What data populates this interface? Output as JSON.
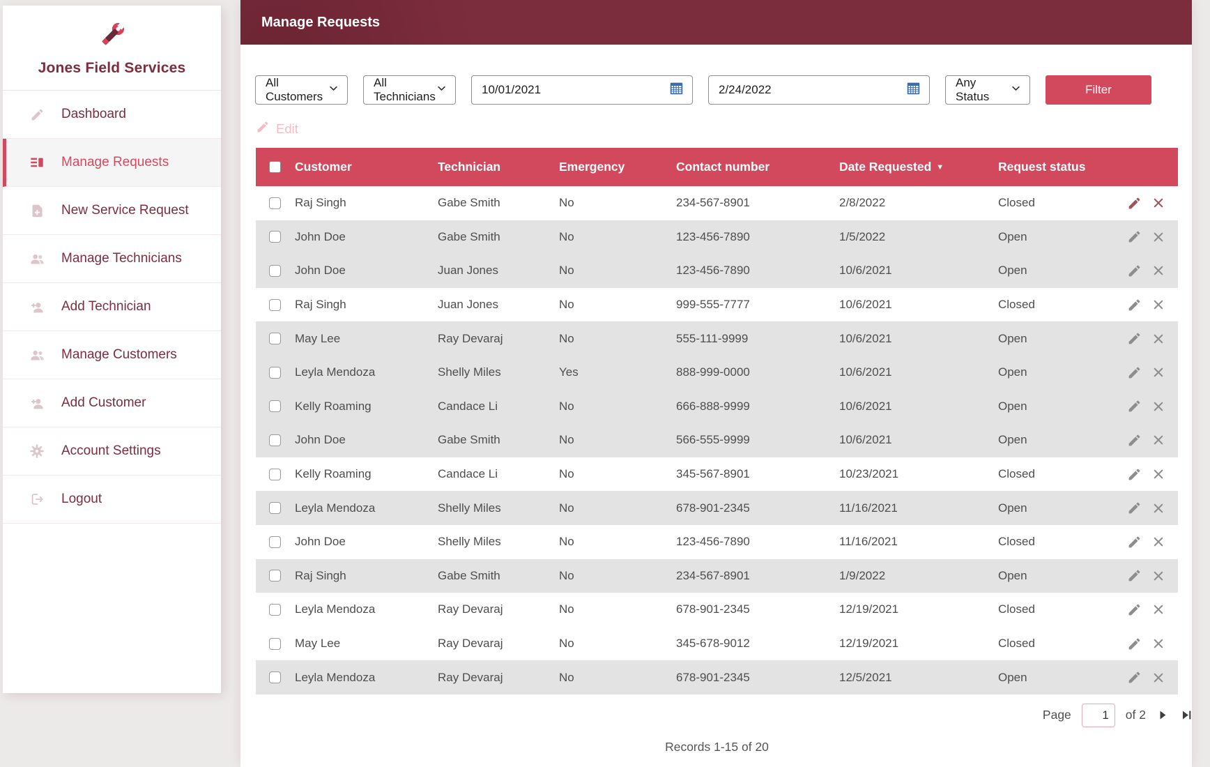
{
  "app": {
    "name": "Jones Field Services",
    "logo_icon": "wrench-icon"
  },
  "sidebar": {
    "items": [
      {
        "label": "Dashboard",
        "slug": "dashboard",
        "icon": "pencil-icon",
        "active": false
      },
      {
        "label": "Manage Requests",
        "slug": "manage-requests",
        "icon": "list-detail-icon",
        "active": true
      },
      {
        "label": "New Service Request",
        "slug": "new-service-request",
        "icon": "document-add-icon",
        "active": false
      },
      {
        "label": "Manage Technicians",
        "slug": "manage-technicians",
        "icon": "people-icon",
        "active": false
      },
      {
        "label": "Add Technician",
        "slug": "add-technician",
        "icon": "person-add-icon",
        "active": false
      },
      {
        "label": "Manage Customers",
        "slug": "manage-customers",
        "icon": "people-icon",
        "active": false
      },
      {
        "label": "Add Customer",
        "slug": "add-customer",
        "icon": "person-add-icon",
        "active": false
      },
      {
        "label": "Account Settings",
        "slug": "account-settings",
        "icon": "gear-icon",
        "active": false
      },
      {
        "label": "Logout",
        "slug": "logout",
        "icon": "logout-icon",
        "active": false
      }
    ]
  },
  "header": {
    "title": "Manage Requests"
  },
  "filters": {
    "customer_select": "All Customers",
    "technician_select": "All Technicians",
    "date_from": "10/01/2021",
    "date_to": "2/24/2022",
    "status_select": "Any Status",
    "filter_button": "Filter"
  },
  "toolbar": {
    "edit_label": "Edit"
  },
  "table": {
    "columns": [
      {
        "label": "Customer"
      },
      {
        "label": "Technician"
      },
      {
        "label": "Emergency"
      },
      {
        "label": "Contact number"
      },
      {
        "label": "Date Requested",
        "sorted": "desc"
      },
      {
        "label": "Request status"
      }
    ],
    "rows": [
      {
        "customer": "Raj Singh",
        "technician": "Gabe Smith",
        "emergency": "No",
        "contact_number": "234-567-8901",
        "date_requested": "2/8/2022",
        "request_status": "Closed",
        "shaded": false
      },
      {
        "customer": "John Doe",
        "technician": "Gabe Smith",
        "emergency": "No",
        "contact_number": "123-456-7890",
        "date_requested": "1/5/2022",
        "request_status": "Open",
        "shaded": true
      },
      {
        "customer": "John Doe",
        "technician": "Juan Jones",
        "emergency": "No",
        "contact_number": "123-456-7890",
        "date_requested": "10/6/2021",
        "request_status": "Open",
        "shaded": true
      },
      {
        "customer": "Raj Singh",
        "technician": "Juan Jones",
        "emergency": "No",
        "contact_number": "999-555-7777",
        "date_requested": "10/6/2021",
        "request_status": "Closed",
        "shaded": false
      },
      {
        "customer": "May Lee",
        "technician": "Ray Devaraj",
        "emergency": "No",
        "contact_number": "555-111-9999",
        "date_requested": "10/6/2021",
        "request_status": "Open",
        "shaded": true
      },
      {
        "customer": "Leyla Mendoza",
        "technician": "Shelly Miles",
        "emergency": "Yes",
        "contact_number": "888-999-0000",
        "date_requested": "10/6/2021",
        "request_status": "Open",
        "shaded": true
      },
      {
        "customer": "Kelly Roaming",
        "technician": "Candace Li",
        "emergency": "No",
        "contact_number": "666-888-9999",
        "date_requested": "10/6/2021",
        "request_status": "Open",
        "shaded": true
      },
      {
        "customer": "John Doe",
        "technician": "Gabe Smith",
        "emergency": "No",
        "contact_number": "566-555-9999",
        "date_requested": "10/6/2021",
        "request_status": "Open",
        "shaded": true
      },
      {
        "customer": "Kelly Roaming",
        "technician": "Candace Li",
        "emergency": "No",
        "contact_number": "345-567-8901",
        "date_requested": "10/23/2021",
        "request_status": "Closed",
        "shaded": false
      },
      {
        "customer": "Leyla Mendoza",
        "technician": "Shelly Miles",
        "emergency": "No",
        "contact_number": "678-901-2345",
        "date_requested": "11/16/2021",
        "request_status": "Open",
        "shaded": true
      },
      {
        "customer": "John Doe",
        "technician": "Shelly Miles",
        "emergency": "No",
        "contact_number": "123-456-7890",
        "date_requested": "11/16/2021",
        "request_status": "Closed",
        "shaded": false
      },
      {
        "customer": "Raj Singh",
        "technician": "Gabe Smith",
        "emergency": "No",
        "contact_number": "234-567-8901",
        "date_requested": "1/9/2022",
        "request_status": "Open",
        "shaded": true
      },
      {
        "customer": "Leyla Mendoza",
        "technician": "Ray Devaraj",
        "emergency": "No",
        "contact_number": "678-901-2345",
        "date_requested": "12/19/2021",
        "request_status": "Closed",
        "shaded": false
      },
      {
        "customer": "May Lee",
        "technician": "Ray Devaraj",
        "emergency": "No",
        "contact_number": "345-678-9012",
        "date_requested": "12/19/2021",
        "request_status": "Closed",
        "shaded": false
      },
      {
        "customer": "Leyla Mendoza",
        "technician": "Ray Devaraj",
        "emergency": "No",
        "contact_number": "678-901-2345",
        "date_requested": "12/5/2021",
        "request_status": "Open",
        "shaded": true
      }
    ]
  },
  "pagination": {
    "page_label": "Page",
    "page_value": "1",
    "total_label": "of 2"
  },
  "footer": {
    "records_summary": "Records 1-15 of 20"
  },
  "colors": {
    "header_maroon": "#7c2d3d",
    "accent_red": "#d2495d",
    "row_shade": "#e4e3e3",
    "disabled_pink": "#f3bcc5"
  }
}
